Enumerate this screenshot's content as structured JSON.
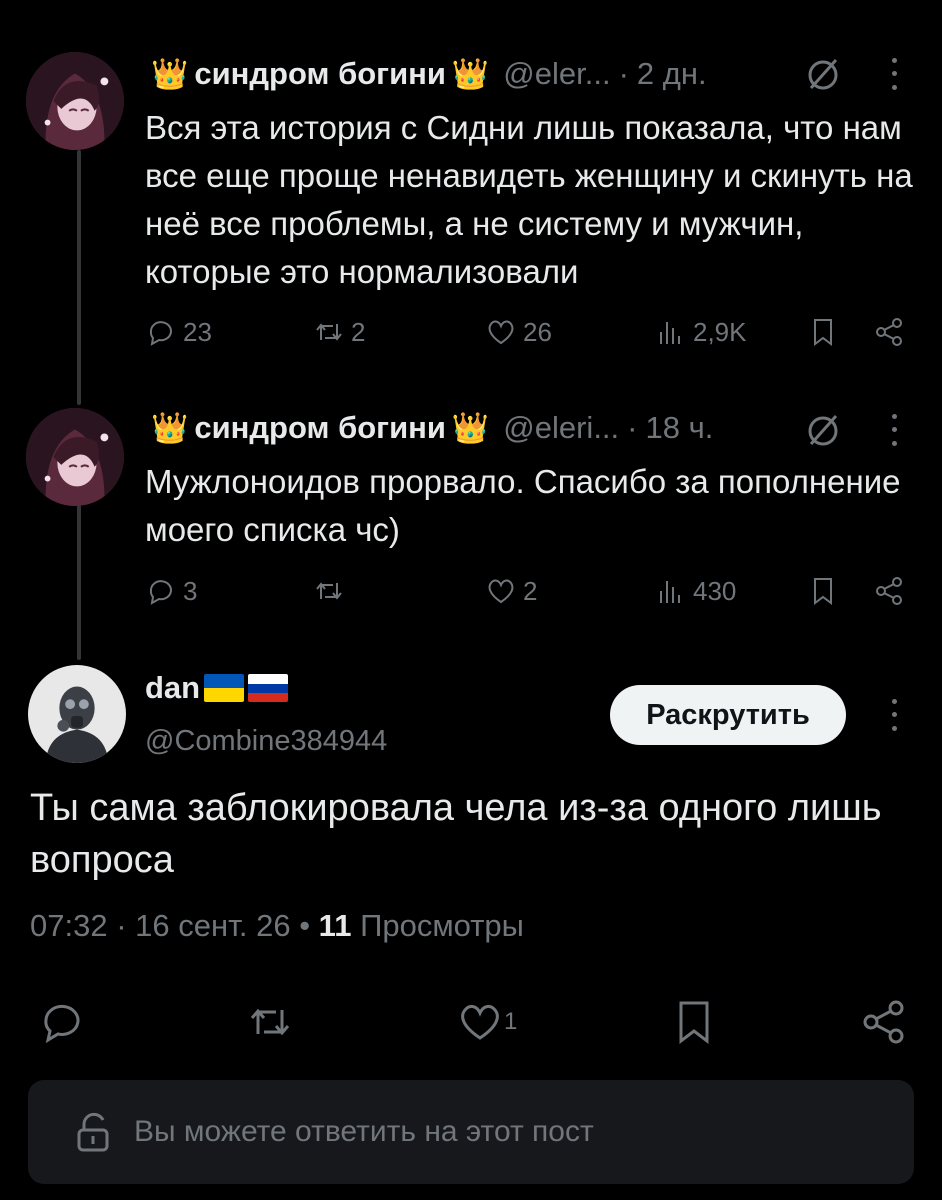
{
  "tweets": [
    {
      "crown": "👑",
      "name": "синдром богини",
      "handle": "@eler...",
      "time": "2 дн.",
      "text": "Вся эта история с Сидни лишь показала, что нам все еще проще ненавидеть женщину и скинуть на неё все проблемы, а не систему и мужчин, которые это нормализовали",
      "replies": "23",
      "retweets": "2",
      "likes": "26",
      "views": "2,9K"
    },
    {
      "crown": "👑",
      "name": "синдром богини",
      "handle": "@eleri...",
      "time": "18 ч.",
      "text": "Мужлоноидов прорвало. Спасибо за пополнение моего списка чс)",
      "replies": "3",
      "retweets": "",
      "likes": "2",
      "views": "430"
    }
  ],
  "main": {
    "name": "dan",
    "handle": "@Combine384944",
    "unroll_label": "Раскрутить",
    "text": "Ты сама заблокировала чела из-за одного лишь вопроса",
    "time": "07:32",
    "date": "16 сент. 26",
    "views_count": "11",
    "views_label": "Просмотры",
    "likes": "1"
  },
  "reply_bar": {
    "text": "Вы можете ответить на этот пост"
  },
  "colors": {
    "background": "#000000",
    "text": "#e7e9ea",
    "muted": "#71767b",
    "button_bg": "#eff3f4",
    "reply_bar_bg": "#16181c"
  },
  "icons": [
    "reply-icon",
    "retweet-icon",
    "like-icon",
    "views-icon",
    "bookmark-icon",
    "share-icon",
    "grok-icon",
    "more-icon",
    "lock-icon"
  ]
}
